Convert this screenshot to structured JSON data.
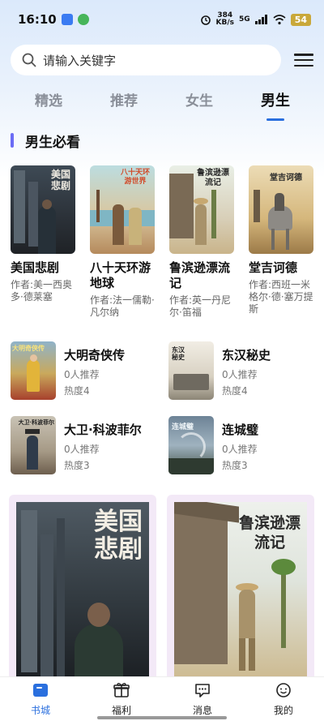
{
  "status_bar": {
    "time": "16:10",
    "net_speed_top": "384",
    "net_speed_bottom": "KB/s",
    "network": "5G",
    "battery": "54"
  },
  "search": {
    "placeholder": "请输入关键字"
  },
  "tabs": [
    {
      "label": "精选",
      "active": false
    },
    {
      "label": "推荐",
      "active": false
    },
    {
      "label": "女生",
      "active": false
    },
    {
      "label": "男生",
      "active": true
    }
  ],
  "section": {
    "title": "男生必看"
  },
  "featured_books": [
    {
      "title": "美国悲剧",
      "author": "作者:美一西奥多·德莱塞",
      "cover_text": "美国悲剧"
    },
    {
      "title": "八十天环游地球",
      "author": "作者:法一儒勒·凡尔纳",
      "cover_text": "八十天环游世界"
    },
    {
      "title": "鲁滨逊漂流记",
      "author": "作者:英一丹尼尔·笛福",
      "cover_text": "鲁滨逊漂流记"
    },
    {
      "title": "堂吉诃德",
      "author": "作者:西班一米格尔·德·塞万提斯",
      "cover_text": "堂吉诃德"
    }
  ],
  "list_books": [
    {
      "title": "大明奇侠传",
      "recommend": "0人推荐",
      "heat": "热度4",
      "cover_text": "大明奇侠传"
    },
    {
      "title": "东汉秘史",
      "recommend": "0人推荐",
      "heat": "热度4",
      "cover_text": "东汉秘史"
    },
    {
      "title": "大卫·科波菲尔",
      "recommend": "0人推荐",
      "heat": "热度3",
      "cover_text": "大卫·科波菲尔"
    },
    {
      "title": "连城璧",
      "recommend": "0人推荐",
      "heat": "热度3",
      "cover_text": "连城璧"
    }
  ],
  "big_cards": [
    {
      "cover_text": "美国悲剧"
    },
    {
      "cover_text": "鲁滨逊漂流记"
    }
  ],
  "bottom_nav": [
    {
      "label": "书城",
      "icon": "book-icon",
      "active": true
    },
    {
      "label": "福利",
      "icon": "gift-icon",
      "active": false
    },
    {
      "label": "消息",
      "icon": "message-icon",
      "active": false
    },
    {
      "label": "我的",
      "icon": "profile-icon",
      "active": false
    }
  ],
  "colors": {
    "accent": "#2a6fde",
    "section_bar": "#6b6cf5",
    "header_gradient_top": "#dbe9fb"
  }
}
